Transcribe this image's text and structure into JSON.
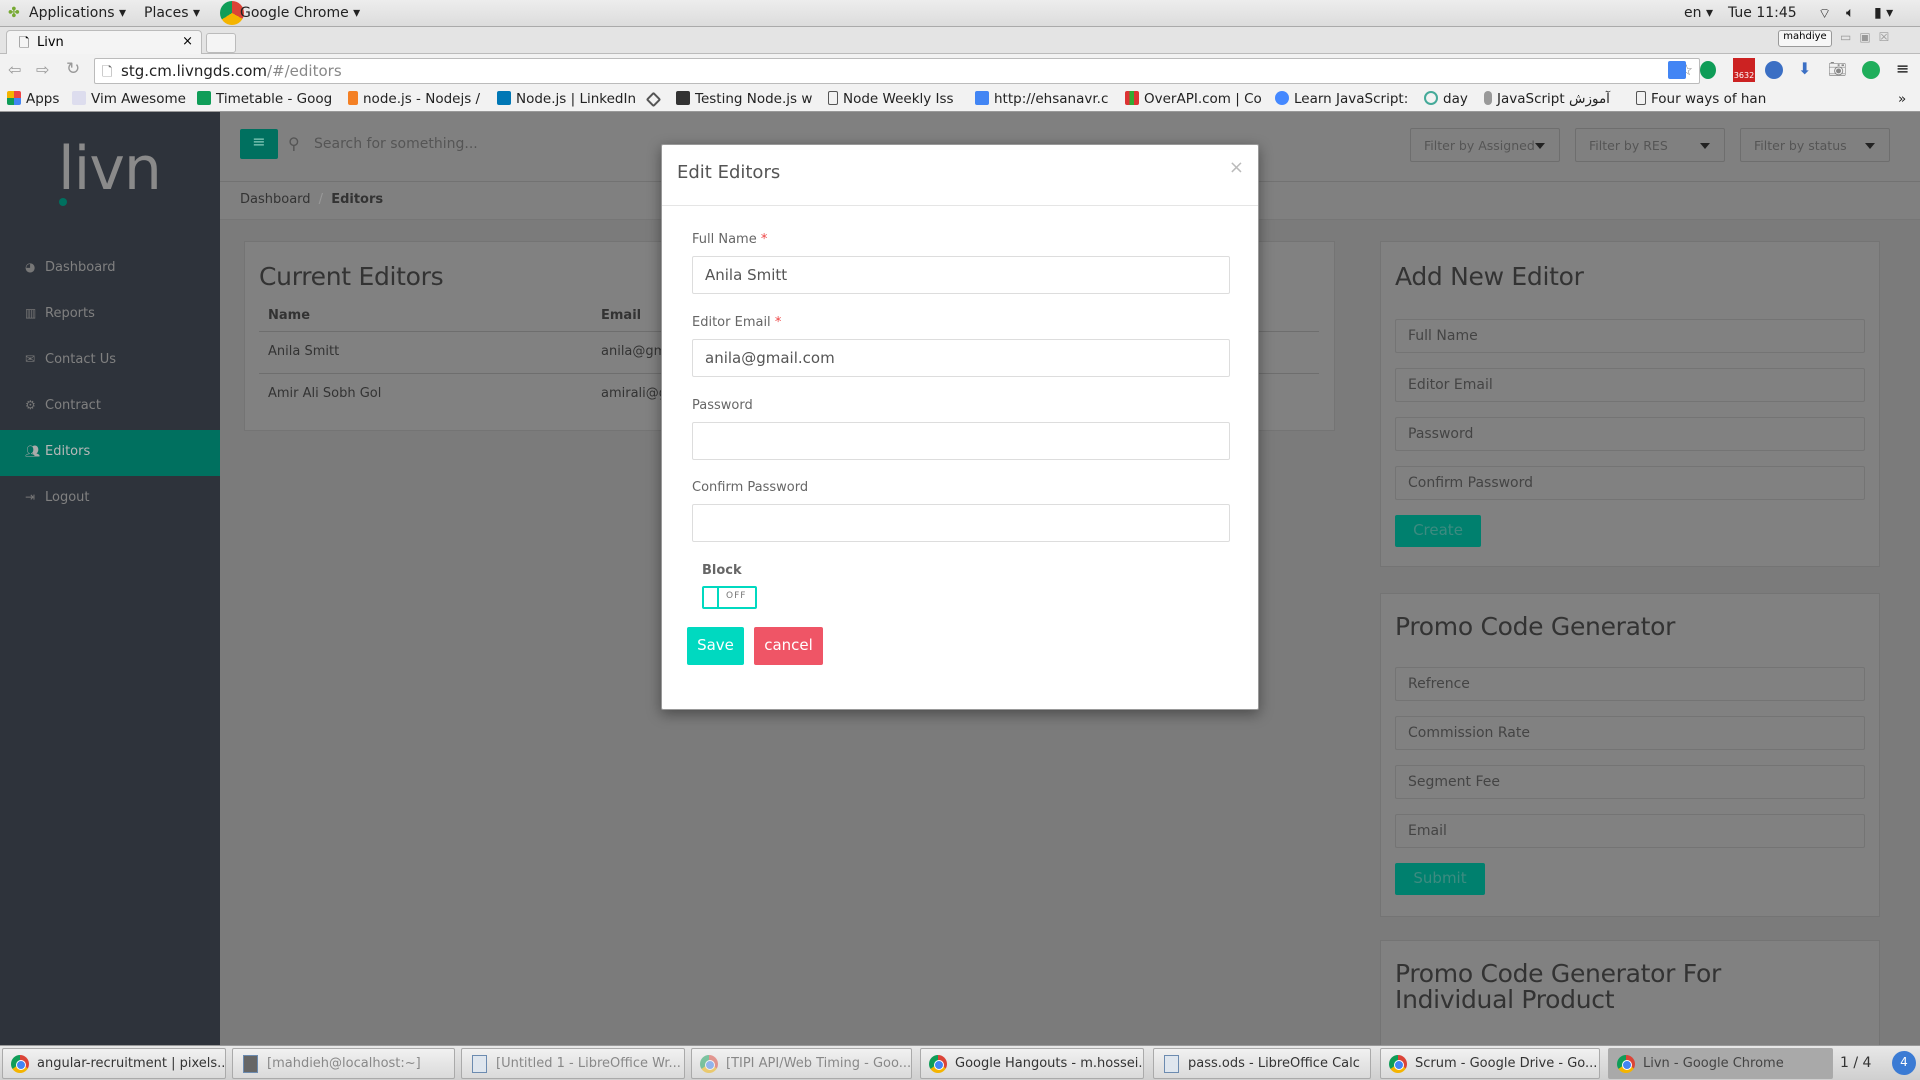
{
  "os": {
    "applications": "Applications",
    "places": "Places",
    "active_app": "Google Chrome",
    "lang": "en",
    "clock": "Tue 11:45"
  },
  "browser": {
    "tab_title": "Livn",
    "url_host": "stg.cm.livngds.com",
    "url_path": "/#/editors",
    "profile": "mahdiye",
    "gmail_badge": "3632",
    "bookmarks": [
      "Apps",
      "Vim Awesome",
      "Timetable - Goog",
      "node.js - Nodejs /",
      "Node.js | LinkedIn",
      "",
      "Testing Node.js w",
      "Node Weekly Iss",
      "http://ehsanavr.c",
      "OverAPI.com | Co",
      "Learn JavaScript:",
      "day",
      "JavaScript آموزش",
      "Four ways of han"
    ]
  },
  "app": {
    "logo": "livn",
    "search_placeholder": "Search for something...",
    "nav": [
      {
        "label": "Dashboard",
        "icon": "dashboard-icon"
      },
      {
        "label": "Reports",
        "icon": "bar-chart-icon"
      },
      {
        "label": "Contact Us",
        "icon": "envelope-icon"
      },
      {
        "label": "Contract",
        "icon": "gear-icon"
      },
      {
        "label": "Editors",
        "icon": "users-icon",
        "active": true
      },
      {
        "label": "Logout",
        "icon": "sign-out-icon"
      }
    ],
    "filters": [
      "Filter by Assigned",
      "Filter by RES",
      "Filter by status"
    ],
    "breadcrumb": [
      "Dashboard",
      "Editors"
    ],
    "current_editors": {
      "title": "Current Editors",
      "columns": [
        "Name",
        "Email"
      ],
      "rows": [
        [
          "Anila Smitt",
          "anila@gm"
        ],
        [
          "Amir Ali Sobh Gol",
          "amirali@g"
        ]
      ]
    },
    "add_editor": {
      "title": "Add New Editor",
      "placeholders": [
        "Full Name",
        "Editor Email",
        "Password",
        "Confirm Password"
      ],
      "button": "Create"
    },
    "promo": {
      "title": "Promo Code Generator",
      "placeholders": [
        "Refrence",
        "Commission Rate",
        "Segment Fee",
        "Email"
      ],
      "button": "Submit"
    },
    "promo_individual": {
      "title": "Promo Code Generator For Individual Product"
    }
  },
  "modal": {
    "title": "Edit Editors",
    "close": "×",
    "full_name_label": "Full Name",
    "full_name": "Anila Smitt",
    "email_label": "Editor Email",
    "email": "anila@gmail.com",
    "password_label": "Password",
    "confirm_label": "Confirm Password",
    "required_mark": "*",
    "block_label": "Block",
    "toggle_state": "OFF",
    "save": "Save",
    "cancel": "cancel"
  },
  "colors": {
    "accent": "#00d9c0",
    "danger": "#ef5566",
    "sidebar": "#2e333b",
    "sidebar_active": "#00705f"
  },
  "taskbar": {
    "items": [
      "angular-recruitment | pixels...",
      "[mahdieh@localhost:~]",
      "[Untitled 1 - LibreOffice Wr...",
      "[TIPI API/Web Timing - Goo...",
      "Google Hangouts - m.hossei...",
      "pass.ods - LibreOffice Calc",
      "Scrum - Google Drive - Go...",
      "Livn - Google Chrome"
    ],
    "workspace": "1 / 4",
    "notifications": "4"
  }
}
